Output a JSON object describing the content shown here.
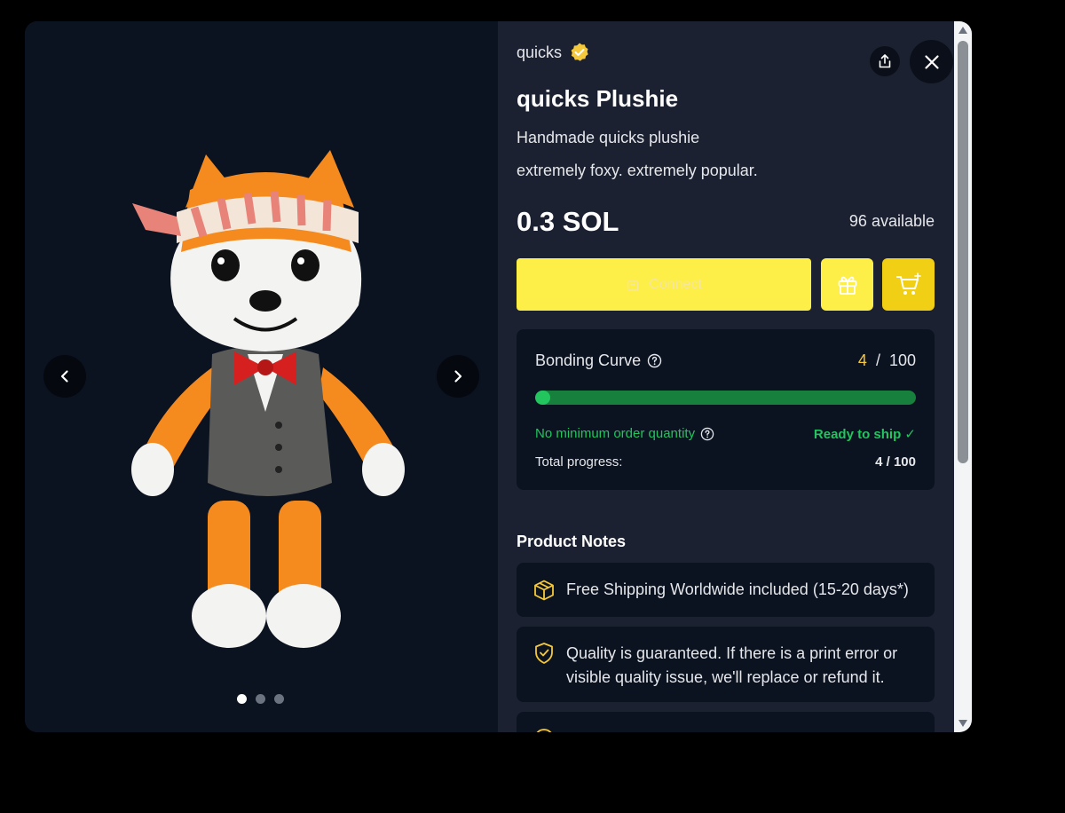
{
  "gallery": {
    "image_alt": "quicks plushie photo",
    "prev_icon": "chevron-left-icon",
    "next_icon": "chevron-right-icon",
    "dots": [
      true,
      false,
      false
    ]
  },
  "creator": {
    "name": "quicks",
    "verified": true
  },
  "actions": {
    "share_icon": "share-icon",
    "close_icon": "close-icon"
  },
  "product": {
    "title": "quicks Plushie",
    "description_line1": "Handmade quicks plushie",
    "description_line2": "extremely foxy. extremely popular.",
    "price": "0.3 SOL",
    "available": "96 available"
  },
  "buttons": {
    "connect_label": "Connect",
    "gift_icon": "gift-icon",
    "cart_icon": "cart-plus-icon"
  },
  "bonding_curve": {
    "title": "Bonding Curve",
    "current": "4",
    "separator": "/",
    "total": "100",
    "progress_fraction": 0.04,
    "moq_label": "No minimum order quantity",
    "ready_label": "Ready to ship ✓",
    "total_progress_label": "Total progress:",
    "total_progress_value": "4 / 100"
  },
  "product_notes": {
    "title": "Product Notes",
    "items": [
      {
        "icon": "box-icon",
        "text": "Free Shipping Worldwide included (15-20 days*)"
      },
      {
        "icon": "shield-check-icon",
        "text": "Quality is guaranteed. If there is a print error or visible quality issue, we'll replace or refund it."
      },
      {
        "icon": "info-icon",
        "text": ""
      }
    ]
  },
  "colors": {
    "accent_yellow": "#fdee48",
    "cart_yellow": "#f0cf14",
    "progress_green": "#22c55e",
    "panel_bg": "#1b2130",
    "card_bg": "#0b1220"
  }
}
